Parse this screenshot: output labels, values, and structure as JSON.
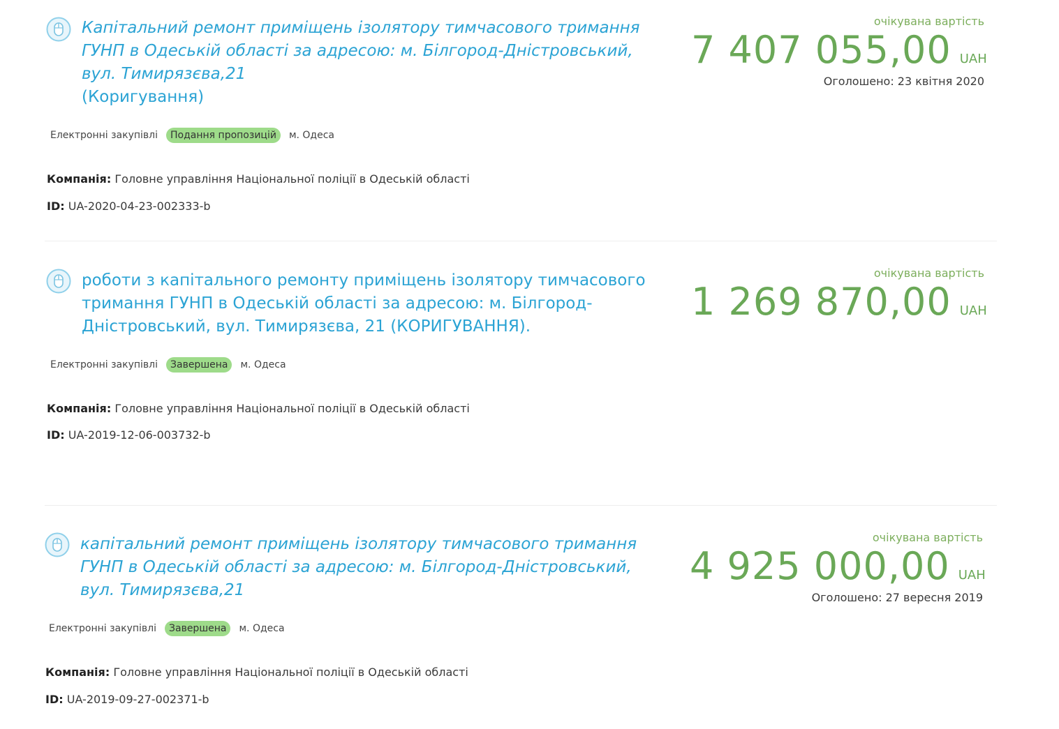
{
  "colors": {
    "link": "#2ba3d4",
    "price": "#6aa857",
    "price_label": "#7cae5c",
    "status_badge": "#9edb8a"
  },
  "tenders": [
    {
      "icon": "mouse-icon",
      "title": "Капітальний ремонт приміщень ізолятору тимчасового тримання ГУНП в Одеській області за адресою: м. Білгород-Дністровський, вул. Тимирязєва,21",
      "title_suffix": "(Коригування)",
      "type": "Електронні закупівлі",
      "status": "Подання пропозицій",
      "city": "м. Одеса",
      "company_label": "Компанія:",
      "company": "Головне управління Національної поліції в Одеській області",
      "id_label": "ID:",
      "id": "UA-2020-04-23-002333-b",
      "price_label": "очікувана вартість",
      "amount": "7 407 055,00",
      "currency": "UAH",
      "announced": "Оголошено: 23 квітня 2020"
    },
    {
      "icon": "mouse-icon",
      "title": "роботи з капітального ремонту приміщень ізолятору тимчасового тримання ГУНП в Одеській області за адресою: м. Білгород-Дністровський, вул. Тимирязєва, 21 (КОРИГУВАННЯ).",
      "title_suffix": "",
      "type": "Електронні закупівлі",
      "status": "Завершена",
      "city": "м. Одеса",
      "company_label": "Компанія:",
      "company": "Головне управління Національної поліції в Одеській області",
      "id_label": "ID:",
      "id": "UA-2019-12-06-003732-b",
      "price_label": "очікувана вартість",
      "amount": "1 269 870,00",
      "currency": "UAH",
      "announced": ""
    },
    {
      "icon": "mouse-icon",
      "title": "капітальний ремонт приміщень ізолятору тимчасового тримання ГУНП в Одеській області за адресою: м. Білгород-Дністровський, вул. Тимирязєва,21",
      "title_suffix": "",
      "type": "Електронні закупівлі",
      "status": "Завершена",
      "city": "м. Одеса",
      "company_label": "Компанія:",
      "company": "Головне управління Національної поліції в Одеській області",
      "id_label": "ID:",
      "id": "UA-2019-09-27-002371-b",
      "price_label": "очікувана вартість",
      "amount": "4 925 000,00",
      "currency": "UAH",
      "announced": "Оголошено: 27 вересня 2019"
    }
  ]
}
